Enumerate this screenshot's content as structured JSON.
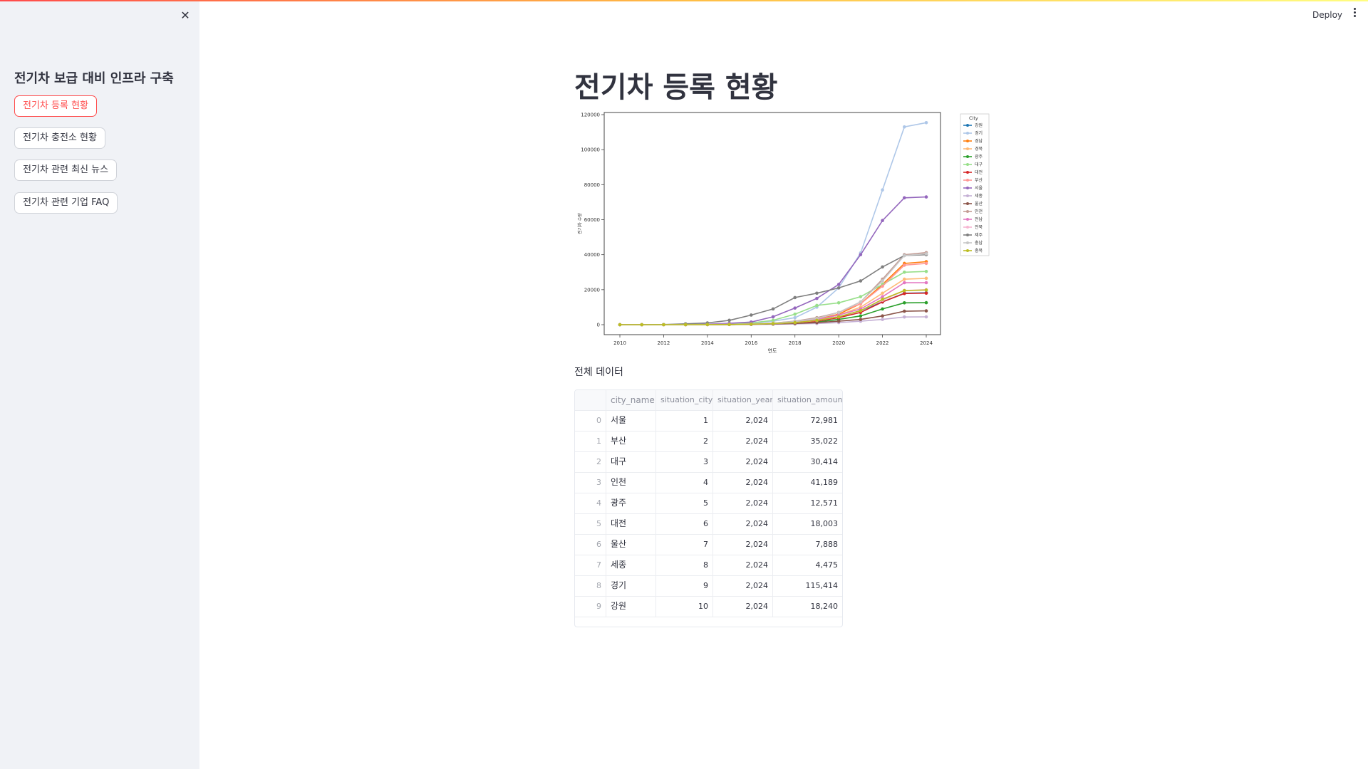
{
  "header": {
    "deploy_label": "Deploy"
  },
  "sidebar": {
    "title": "전기차 보급 대비 인프라 구축",
    "items": [
      {
        "label": "전기차 등록 현황",
        "active": true
      },
      {
        "label": "전기차 충전소 현황",
        "active": false
      },
      {
        "label": "전기차 관련 최신 뉴스",
        "active": false
      },
      {
        "label": "전기차 관련 기업 FAQ",
        "active": false
      }
    ]
  },
  "main": {
    "title": "전기차 등록 현황",
    "table_title": "전체 데이터",
    "table": {
      "columns": [
        "city_name",
        "situation_city",
        "situation_year",
        "situation_amount"
      ],
      "rows": [
        [
          "0",
          "서울",
          "1",
          "2,024",
          "72,981"
        ],
        [
          "1",
          "부산",
          "2",
          "2,024",
          "35,022"
        ],
        [
          "2",
          "대구",
          "3",
          "2,024",
          "30,414"
        ],
        [
          "3",
          "인천",
          "4",
          "2,024",
          "41,189"
        ],
        [
          "4",
          "광주",
          "5",
          "2,024",
          "12,571"
        ],
        [
          "5",
          "대전",
          "6",
          "2,024",
          "18,003"
        ],
        [
          "6",
          "울산",
          "7",
          "2,024",
          "7,888"
        ],
        [
          "7",
          "세종",
          "8",
          "2,024",
          "4,475"
        ],
        [
          "8",
          "경기",
          "9",
          "2,024",
          "115,414"
        ],
        [
          "9",
          "강원",
          "10",
          "2,024",
          "18,240"
        ]
      ]
    }
  },
  "chart_data": {
    "type": "line",
    "xlabel": "연도",
    "ylabel": "전기차 수량",
    "legend_title": "City",
    "legend_position": "right",
    "xlim": [
      2010,
      2024
    ],
    "ylim": [
      0,
      120000
    ],
    "x_ticks": [
      "2010",
      "2012",
      "2014",
      "2016",
      "2018",
      "2020",
      "2022",
      "2024"
    ],
    "y_ticks": [
      "0",
      "20000",
      "40000",
      "60000",
      "80000",
      "100000",
      "120000"
    ],
    "x": [
      2010,
      2011,
      2012,
      2013,
      2014,
      2015,
      2016,
      2017,
      2018,
      2019,
      2020,
      2021,
      2022,
      2023,
      2024
    ],
    "series": [
      {
        "name": "강원",
        "color": "#1f77b4",
        "values": [
          0,
          0,
          0,
          0,
          100,
          200,
          400,
          700,
          1200,
          2500,
          4500,
          8000,
          13000,
          18000,
          18240
        ]
      },
      {
        "name": "경기",
        "color": "#aec7e8",
        "values": [
          0,
          0,
          50,
          100,
          200,
          400,
          800,
          2000,
          4000,
          10000,
          21000,
          41000,
          77000,
          113000,
          115414
        ]
      },
      {
        "name": "경남",
        "color": "#ff7f0e",
        "values": [
          0,
          0,
          0,
          0,
          100,
          200,
          300,
          700,
          1500,
          3000,
          6000,
          12000,
          23000,
          35000,
          36000
        ]
      },
      {
        "name": "경북",
        "color": "#ffbb78",
        "values": [
          0,
          0,
          0,
          0,
          100,
          200,
          300,
          600,
          1300,
          2800,
          5500,
          10000,
          18000,
          26000,
          26500
        ]
      },
      {
        "name": "광주",
        "color": "#2ca02c",
        "values": [
          0,
          0,
          0,
          0,
          50,
          100,
          200,
          400,
          800,
          1500,
          3000,
          5000,
          9000,
          12500,
          12571
        ]
      },
      {
        "name": "대구",
        "color": "#98df8a",
        "values": [
          0,
          0,
          0,
          0,
          200,
          500,
          1000,
          2500,
          6000,
          11000,
          12500,
          16000,
          23000,
          30000,
          30414
        ]
      },
      {
        "name": "대전",
        "color": "#d62728",
        "values": [
          0,
          0,
          0,
          0,
          50,
          100,
          200,
          500,
          1000,
          2000,
          4000,
          7000,
          13000,
          17800,
          18003
        ]
      },
      {
        "name": "부산",
        "color": "#ff9896",
        "values": [
          0,
          0,
          0,
          0,
          100,
          200,
          400,
          900,
          1800,
          3500,
          7000,
          12000,
          22000,
          34000,
          35022
        ]
      },
      {
        "name": "서울",
        "color": "#9467bd",
        "values": [
          0,
          0,
          0,
          0,
          300,
          800,
          1500,
          4500,
          9500,
          15000,
          23000,
          40000,
          59500,
          72500,
          72981
        ]
      },
      {
        "name": "세종",
        "color": "#c5b0d5",
        "values": [
          0,
          0,
          0,
          0,
          0,
          50,
          100,
          200,
          400,
          700,
          1200,
          2000,
          3000,
          4400,
          4475
        ]
      },
      {
        "name": "울산",
        "color": "#8c564b",
        "values": [
          0,
          0,
          0,
          0,
          50,
          100,
          200,
          400,
          700,
          1200,
          2000,
          3000,
          5000,
          7700,
          7888
        ]
      },
      {
        "name": "인천",
        "color": "#c49c94",
        "values": [
          0,
          0,
          0,
          0,
          100,
          200,
          400,
          900,
          2000,
          4000,
          7000,
          13000,
          26000,
          40000,
          41189
        ]
      },
      {
        "name": "전남",
        "color": "#e377c2",
        "values": [
          0,
          0,
          0,
          0,
          100,
          200,
          400,
          800,
          1600,
          3000,
          5500,
          9000,
          16000,
          24000,
          24000
        ]
      },
      {
        "name": "전북",
        "color": "#f7b6d2",
        "values": [
          0,
          0,
          0,
          0,
          50,
          100,
          300,
          600,
          1200,
          2400,
          4500,
          8000,
          14000,
          19500,
          20000
        ]
      },
      {
        "name": "제주",
        "color": "#7f7f7f",
        "values": [
          0,
          0,
          100,
          500,
          1000,
          2500,
          5500,
          9000,
          15500,
          18000,
          21000,
          25000,
          33000,
          39500,
          40000
        ]
      },
      {
        "name": "충남",
        "color": "#c7c7c7",
        "values": [
          0,
          0,
          0,
          0,
          100,
          200,
          400,
          900,
          1800,
          3500,
          7000,
          13000,
          25000,
          39500,
          40500
        ]
      },
      {
        "name": "충북",
        "color": "#bcbd22",
        "values": [
          0,
          0,
          0,
          0,
          50,
          100,
          300,
          600,
          1200,
          2500,
          4500,
          8000,
          14500,
          19500,
          19800
        ]
      }
    ]
  }
}
